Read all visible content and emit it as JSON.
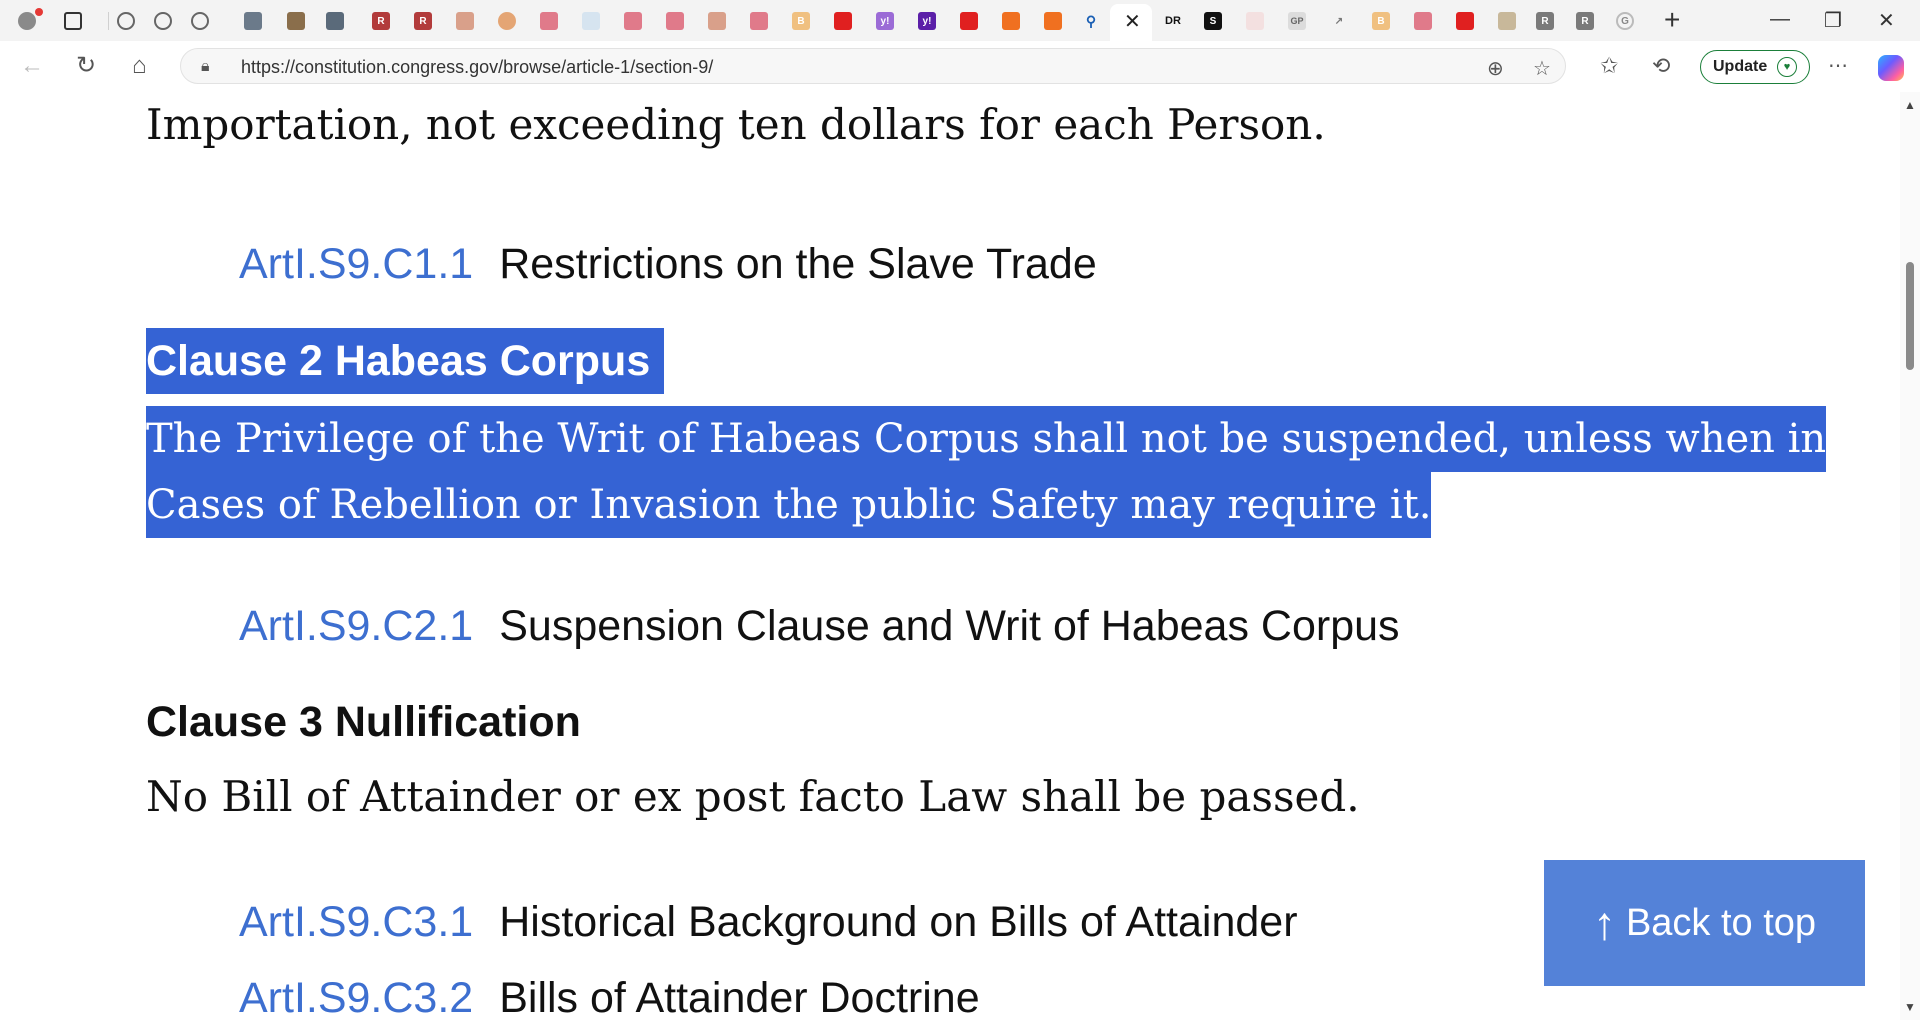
{
  "browser": {
    "active_tab_close": "✕",
    "new_tab": "+",
    "window_controls": {
      "minimize": "—",
      "restore": "❐",
      "close": "✕"
    },
    "tab_icons": [
      "profile-icon",
      "tab-actions-icon",
      "globe-icon",
      "globe-icon",
      "globe-icon",
      "news-icon",
      "bookmark-icon",
      "chevrons-icon",
      "r-icon",
      "r-icon",
      "pdf-icon",
      "circle-icon",
      "youtube-icon",
      "feather-icon",
      "youtube-icon",
      "youtube-icon",
      "pdf-icon",
      "youtube-icon",
      "b-icon",
      "youtube-icon",
      "yahoo-icon",
      "yahoo-icon",
      "youtube-icon",
      "bookmark-icon",
      "bookmark-icon",
      "search-icon"
    ],
    "tab_icons_after_active": [
      "dr-icon",
      "s-icon",
      "bird-icon",
      "gp-icon",
      "chart-icon",
      "b-icon",
      "youtube-icon",
      "youtube-icon",
      "image-icon",
      "r-icon",
      "r-icon",
      "google-icon"
    ],
    "url": "https://constitution.congress.gov/browse/article-1/section-9/",
    "update_label": "Update"
  },
  "colors": {
    "link": "#3d6fd0",
    "selection": "#3563d4",
    "back_to_top_bg": "#5482d8"
  },
  "content": {
    "top_text": "Importation, not exceeding ten dollars for each Person.",
    "items": [
      {
        "ref": "ArtI.S9.C1.1",
        "title": "Restrictions on the Slave Trade"
      },
      {
        "ref": "ArtI.S9.C2.1",
        "title": "Suspension Clause and Writ of Habeas Corpus"
      },
      {
        "ref": "ArtI.S9.C3.1",
        "title": "Historical Background on Bills of Attainder"
      },
      {
        "ref": "ArtI.S9.C3.2",
        "title": "Bills of Attainder Doctrine"
      }
    ],
    "clause2_heading": "Clause 2 Habeas Corpus",
    "clause2_line1": "The Privilege of the Writ of Habeas Corpus shall not be suspended, unless when in",
    "clause2_line2": "Cases of Rebellion or Invasion the public Safety may require it.",
    "clause3_heading": "Clause 3 Nullification",
    "clause3_text": "No Bill of Attainder or ex post facto Law shall be passed.",
    "back_to_top": "Back to top"
  }
}
